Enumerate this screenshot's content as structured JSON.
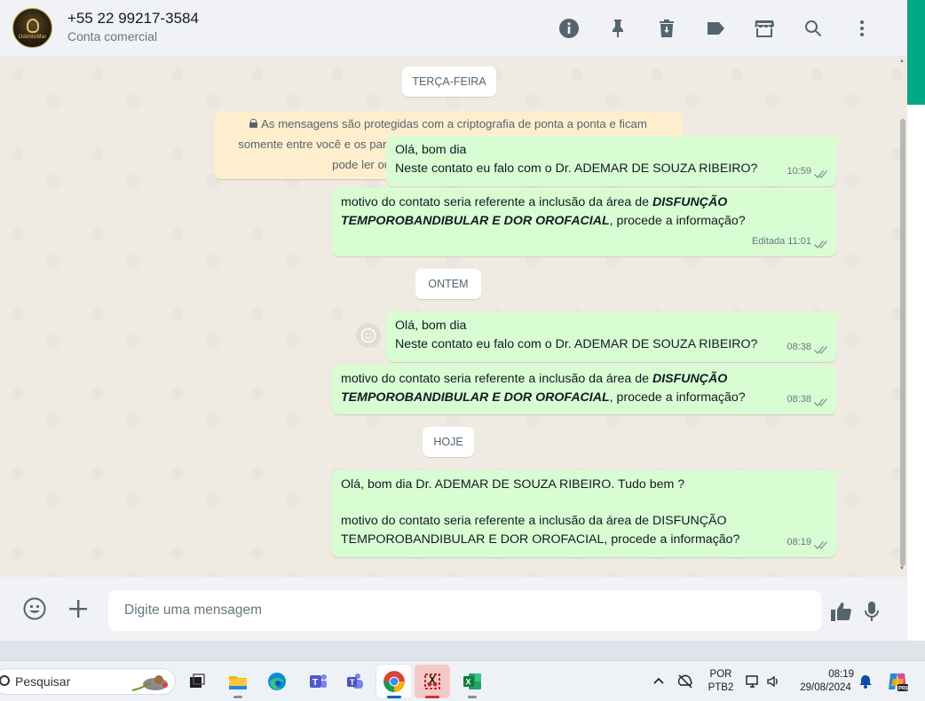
{
  "header": {
    "contact_name": "+55 22 99217-3584",
    "contact_subtitle": "Conta comercial",
    "avatar_text": "OdontoMar",
    "icons": [
      "info-icon",
      "pin-icon",
      "delete-icon",
      "label-icon",
      "store-icon",
      "search-icon",
      "menu-icon"
    ]
  },
  "encryption_notice": {
    "line1": "As mensagens são protegidas com a criptografia de ponta a ponta e ficam",
    "line2": "somente entre você e os participantes desta conversa. Nem mesmo o WhatsApp",
    "line3": "pode ler ou ouvi-las. Clique para saber mais."
  },
  "date_chips": {
    "tuesday": "TERÇA-FEIRA",
    "yesterday": "ONTEM",
    "today": "HOJE"
  },
  "messages": [
    {
      "line1": "Olá, bom dia",
      "line2": "Neste contato eu falo com o Dr. ADEMAR DE SOUZA RIBEIRO?",
      "time": "10:59"
    },
    {
      "prefix": "motivo do contato seria referente a inclusão da área de ",
      "bold1": "DISFUNÇÃO",
      "bold2": "TEMPOROBANDIBULAR E DOR OROFACIAL",
      "suffix": ", procede a informação?",
      "edited": "Editada",
      "time": "11:01"
    },
    {
      "line1": "Olá, bom dia",
      "line2": "Neste contato eu falo com o Dr. ADEMAR DE SOUZA RIBEIRO?",
      "time": "08:38"
    },
    {
      "prefix": "motivo do contato seria referente a inclusão da área de ",
      "bold1": "DISFUNÇÃO",
      "bold2": "TEMPOROBANDIBULAR E DOR OROFACIAL",
      "suffix": ", procede a informação?",
      "time": "08:38"
    },
    {
      "line1": "Olá, bom dia Dr. ADEMAR DE SOUZA RIBEIRO. Tudo bem ?",
      "line2": "motivo do contato seria referente a inclusão da área de DISFUNÇÃO",
      "line3": "TEMPOROBANDIBULAR E DOR OROFACIAL, procede a informação?",
      "time": "08:19"
    }
  ],
  "composer": {
    "placeholder": "Digite uma mensagem"
  },
  "taskbar": {
    "search_label": "Pesquisar",
    "language_line1": "POR",
    "language_line2": "PTB2",
    "clock_time": "08:19",
    "clock_date": "29/08/2024"
  },
  "colors": {
    "outgoing_bubble": "#d9fdd3",
    "header_bg": "#f0f2f5",
    "chat_bg": "#efeae2",
    "accent": "#00a884"
  }
}
